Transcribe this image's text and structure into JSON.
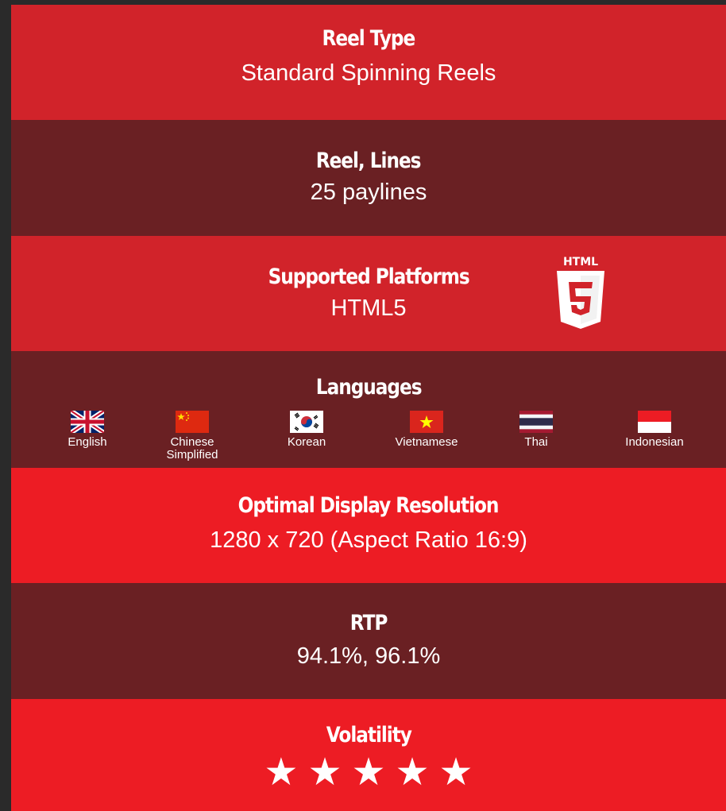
{
  "reel_type": {
    "title": "Reel Type",
    "value": "Standard Spinning Reels"
  },
  "lines": {
    "title": "Reel, Lines",
    "value": "25 paylines"
  },
  "platforms": {
    "title": "Supported Platforms",
    "value": "HTML5",
    "logo_text": "HTML",
    "logo_icon": "html5-logo-icon"
  },
  "languages": {
    "title": "Languages",
    "items": [
      {
        "label": "English",
        "flag": "uk-flag-icon"
      },
      {
        "label": "Chinese Simplified",
        "flag": "china-flag-icon"
      },
      {
        "label": "Korean",
        "flag": "korea-flag-icon"
      },
      {
        "label": "Vietnamese",
        "flag": "vietnam-flag-icon"
      },
      {
        "label": "Thai",
        "flag": "thailand-flag-icon"
      },
      {
        "label": "Indonesian",
        "flag": "indonesia-flag-icon"
      }
    ]
  },
  "resolution": {
    "title": "Optimal Display Resolution",
    "value": "1280 x 720 (Aspect Ratio 16:9)"
  },
  "rtp": {
    "title": "RTP",
    "value": "94.1%, 96.1%"
  },
  "volatility": {
    "title": "Volatility",
    "stars": 5,
    "max_stars": 5,
    "star_glyph": "★★★★★"
  },
  "colors": {
    "red": "#d1232a",
    "dark": "#6a2023",
    "bright_red": "#ed1c24"
  }
}
